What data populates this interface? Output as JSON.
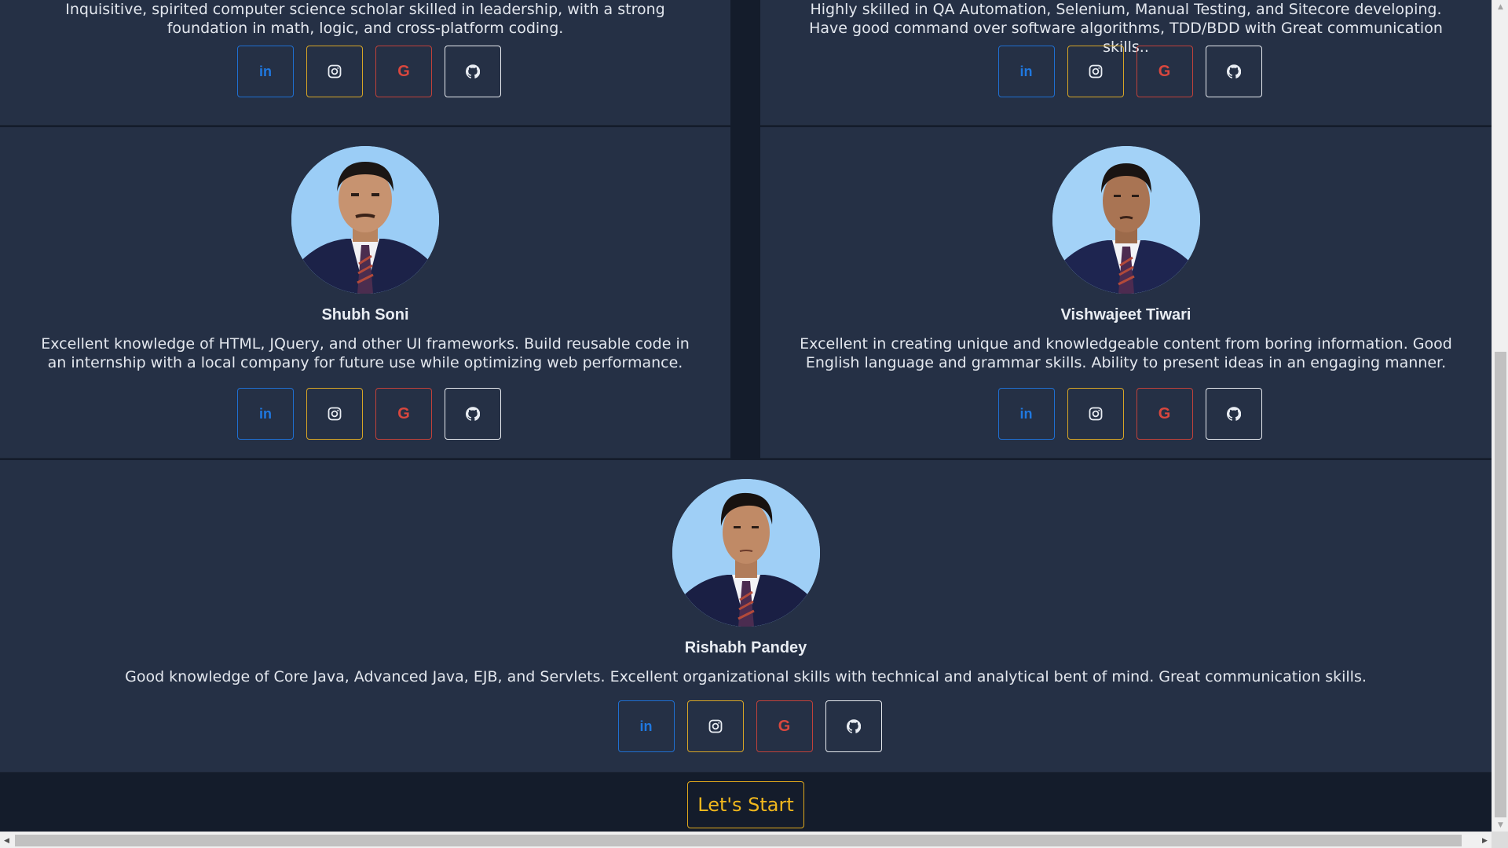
{
  "team": {
    "top_left": {
      "bio": "Inquisitive, spirited computer science scholar skilled in leadership, with a strong foundation in math, logic, and cross-platform coding."
    },
    "top_right": {
      "bio": "Highly skilled in QA Automation, Selenium, Manual Testing, and Sitecore developing. Have good command over software algorithms, TDD/BDD with Great communication skills.."
    },
    "mid_left": {
      "name": "Shubh Soni",
      "bio": "Excellent knowledge of HTML, JQuery, and other UI frameworks. Build reusable code in an internship with a local company for future use while optimizing web performance."
    },
    "mid_right": {
      "name": "Vishwajeet Tiwari",
      "bio": "Excellent in creating unique and knowledgeable content from boring information. Good English language and grammar skills. Ability to present ideas in an engaging manner."
    },
    "bottom": {
      "name": "Rishabh Pandey",
      "bio": "Good knowledge of Core Java, Advanced Java, EJB, and Servlets. Excellent organizational skills with technical and analytical bent of mind. Great communication skills."
    }
  },
  "social": {
    "linkedin_label": "in",
    "google_label": "G",
    "icons": [
      "linkedin-icon",
      "instagram-icon",
      "google-icon",
      "github-icon"
    ]
  },
  "cta": {
    "label": "Let's Start"
  },
  "colors": {
    "page_bg": "#141c2b",
    "card_bg": "#253045",
    "linkedin": "#1f6fd1",
    "instagram": "#d7a526",
    "google": "#c0413a",
    "github": "#e6e9ee",
    "cta": "#f1b81d"
  }
}
